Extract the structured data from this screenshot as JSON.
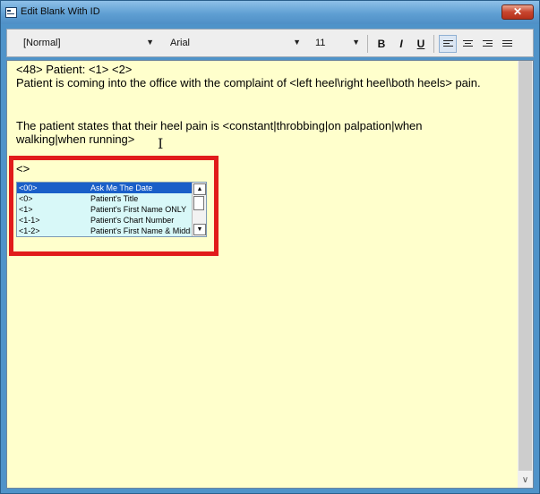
{
  "window": {
    "title": "Edit Blank With ID",
    "close_label": "✕"
  },
  "toolbar": {
    "style_value": "[Normal]",
    "font_value": "Arial",
    "size_value": "11",
    "bold": "B",
    "italic": "I",
    "underline": "U"
  },
  "editor": {
    "lines": [
      "<48> Patient: <1> <2>",
      "Patient is coming into the office with the complaint of <left heel\\right heel\\both heels> pain.",
      "",
      "The patient states that their heel pain is <constant|throbbing|on palpation|when",
      "walking|when running>",
      "",
      "<>"
    ]
  },
  "autocomplete": {
    "items": [
      {
        "code": "<00>",
        "label": "Ask Me The Date",
        "selected": true
      },
      {
        "code": "<0>",
        "label": "Patient's Title"
      },
      {
        "code": "<1>",
        "label": "Patient's First Name ONLY"
      },
      {
        "code": "<1-1>",
        "label": "Patient's Chart Number"
      },
      {
        "code": "<1-2>",
        "label": "Patient's First Name & Middle"
      }
    ]
  },
  "colors": {
    "editor_bg": "#ffffcc",
    "highlight": "#e11b1b",
    "selection": "#1a5fc8"
  }
}
